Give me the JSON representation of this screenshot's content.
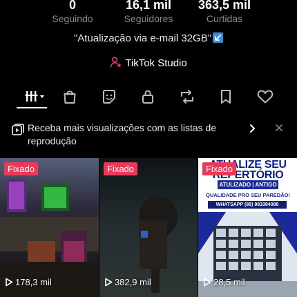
{
  "stats": [
    {
      "value": "0",
      "label": "Seguindo"
    },
    {
      "value": "16,1 mil",
      "label": "Seguidores"
    },
    {
      "value": "363,5 mil",
      "label": "Curtidas"
    }
  ],
  "bio": "\"Atualização via e-mail 32GB\"",
  "studio_label": "TikTok Studio",
  "banner_text": "Receba mais visualizações com as listas de reprodução",
  "videos": [
    {
      "pinned_label": "Fixado",
      "views": "178,3 mil"
    },
    {
      "pinned_label": "Fixado",
      "views": "382,9 mil"
    },
    {
      "pinned_label": "Fixado",
      "views": "28,5 mil",
      "poster_title": "ATUALIZE SEU REPERTÓRIO",
      "poster_sub": "ATULIZADO | ANTIGO",
      "poster_tag": "QUALIDADE PRO SEU PAREDÃO!",
      "poster_phone": "WHATSAPP (88) 983384088"
    }
  ]
}
